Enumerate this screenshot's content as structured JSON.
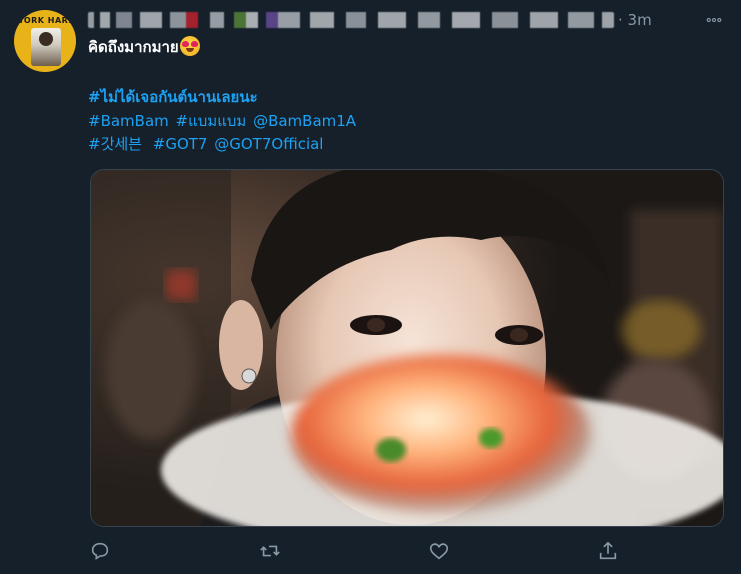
{
  "avatar": {
    "badge_text": "WORK HARD"
  },
  "header": {
    "timestamp": "· 3m",
    "more_icon": "more-horizontal-icon"
  },
  "tweet": {
    "line1": "คิดถึงมากมาย",
    "emoji": "heart-eyes-emoji",
    "hashtag_bold": "#ไม่ได้เจอกันต์นานเลยนะ",
    "line2": [
      "#BamBam",
      "#แบมแบม",
      "@BamBam1A"
    ],
    "line3": [
      "#갓세븐",
      "#GOT7",
      "@GOT7Official"
    ]
  },
  "actions": {
    "reply": "reply-icon",
    "retweet": "retweet-icon",
    "like": "like-icon",
    "share": "share-icon"
  },
  "colors": {
    "background": "#15202b",
    "link": "#1da1f2",
    "muted": "#8899a6"
  }
}
